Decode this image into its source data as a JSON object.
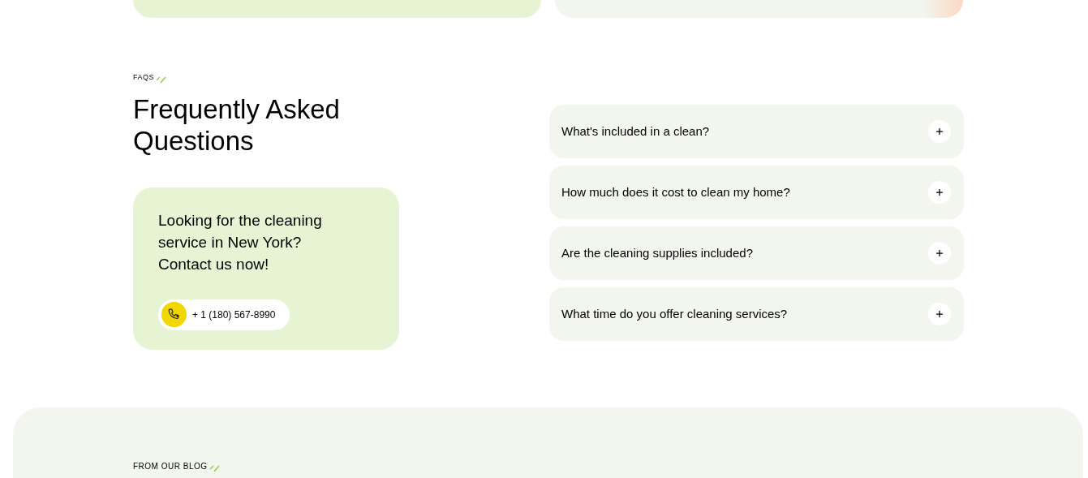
{
  "faq_section": {
    "eyebrow": "FAQS",
    "heading": "Frequently Asked Questions",
    "contact_card": {
      "text": "Looking for the cleaning service in New York? Contact us now!",
      "phone": "+ 1 (180) 567-8990"
    },
    "questions": [
      {
        "question": "What's included in a clean?",
        "expanded": false
      },
      {
        "question": "How much does it cost to clean my home?",
        "expanded": false
      },
      {
        "question": "Are the cleaning supplies included?",
        "expanded": false
      },
      {
        "question": "What time do you offer cleaning services?",
        "expanded": false
      }
    ]
  },
  "blog_section": {
    "eyebrow": "FROM OUR BLOG"
  }
}
